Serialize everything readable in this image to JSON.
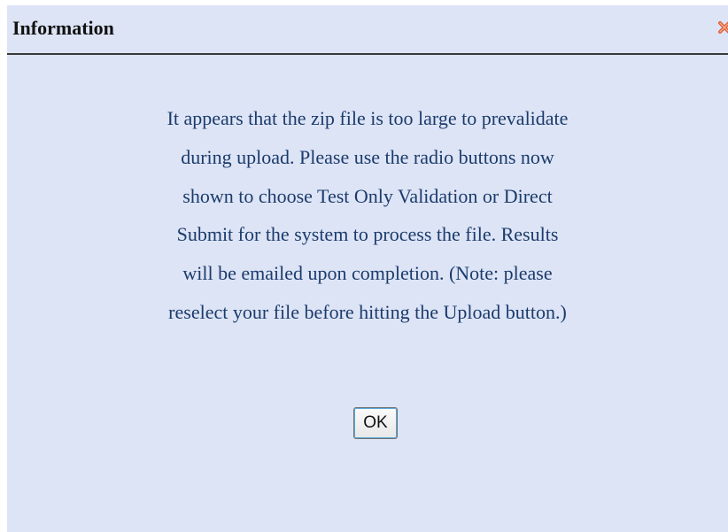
{
  "dialog": {
    "title": "Information",
    "close_icon": "close-x-icon",
    "message_lines": [
      "It appears that the zip file is too large to prevalidate",
      "during upload. Please use the radio buttons now",
      "shown to choose Test Only Validation or Direct",
      "Submit for the system to process the file. Results",
      "will be emailed upon completion. (Note: please",
      "reselect your file before hitting the Upload button.)"
    ],
    "ok_label": "OK"
  },
  "colors": {
    "dialog_background": "#dde4f6",
    "message_text": "#1b3b6b",
    "close_icon": "#e0603a"
  }
}
